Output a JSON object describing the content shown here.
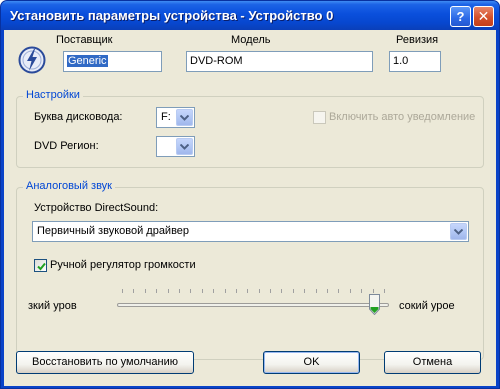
{
  "window": {
    "title": "Установить параметры устройства - Устройство 0",
    "help_glyph": "?",
    "close_glyph": "✕"
  },
  "device": {
    "vendor_label": "Поставщик",
    "vendor_value": "Generic",
    "model_label": "Модель",
    "model_value": "DVD-ROM",
    "revision_label": "Ревизия",
    "revision_value": "1.0",
    "icon": "drive-lightning-icon"
  },
  "settings": {
    "group_title": "Настройки",
    "drive_letter_label": "Буква дисковода:",
    "drive_letter_value": "F:",
    "auto_notify_label": "Включить авто уведомление",
    "auto_notify_checked": false,
    "auto_notify_enabled": false,
    "dvd_region_label": "DVD Регион:",
    "dvd_region_value": ""
  },
  "analog_audio": {
    "group_title": "Аналоговый звук",
    "directsound_label": "Устройство DirectSound:",
    "directsound_value": "Первичный звуковой драйвер",
    "manual_volume_label": "Ручной регулятор громкости",
    "manual_volume_checked": true,
    "slider_low_label": "зкий уров",
    "slider_high_label": "сокий урое",
    "slider_level": 0.98
  },
  "buttons": {
    "restore_defaults": "Восстановить по умолчанию",
    "ok": "OK",
    "cancel": "Отмена"
  },
  "colors": {
    "titlebar": "#0a4fdc",
    "group_title": "#0046d5",
    "selection": "#316ac5",
    "face": "#ece9d8"
  }
}
